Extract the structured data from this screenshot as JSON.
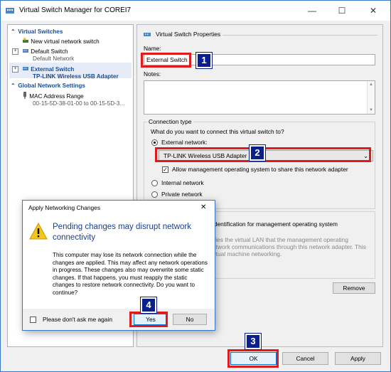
{
  "window": {
    "title": "Virtual Switch Manager for COREI7",
    "minimize": "—",
    "maximize": "☐",
    "close": "✕"
  },
  "tree": {
    "virtual_switches_header": "Virtual Switches",
    "new_switch": "New virtual network switch",
    "default_switch": "Default Switch",
    "default_switch_sub": "Default Network",
    "external_switch": "External Switch",
    "external_switch_sub": "TP-LINK Wireless USB Adapter",
    "global_header": "Global Network Settings",
    "mac_range": "MAC Address Range",
    "mac_range_sub": "00-15-5D-38-01-00 to 00-15-5D-3..."
  },
  "props": {
    "header": "Virtual Switch Properties",
    "name_label": "Name:",
    "name_value": "External Switch",
    "notes_label": "Notes:",
    "connection_type": "Connection type",
    "question": "What do you want to connect this virtual switch to?",
    "external_network": "External network:",
    "adapter_value": "TP-LINK Wireless USB Adapter",
    "allow_mgmt": "Allow management operating system to share this network adapter",
    "internal_network": "Internal network",
    "private_network": "Private network",
    "vlan_heading": "identification for management operating system",
    "vlan_desc_1": "ifies the virtual LAN that the management operating",
    "vlan_desc_2": "etwork communications through this network adapter. This",
    "vlan_desc_3": "irtual machine networking.",
    "remove_button": "Remove"
  },
  "footer": {
    "ok": "OK",
    "cancel": "Cancel",
    "apply": "Apply"
  },
  "dialog": {
    "title": "Apply Networking Changes",
    "close": "✕",
    "heading": "Pending changes may disrupt network connectivity",
    "body": "This computer may lose its network connection while the changes are applied. This may affect any network operations in progress. These changes also may overwrite some static changes. If that happens, you must reapply the static changes to restore network connectivity. Do you want to continue?",
    "dont_ask": "Please don't ask me again",
    "yes": "Yes",
    "no": "No"
  },
  "badges": [
    "1",
    "2",
    "3",
    "4"
  ],
  "colors": {
    "highlight_red": "#e01b1b",
    "badge_navy": "#0b1f8a",
    "link_blue": "#1a4d99",
    "window_border": "#3a78c4"
  }
}
